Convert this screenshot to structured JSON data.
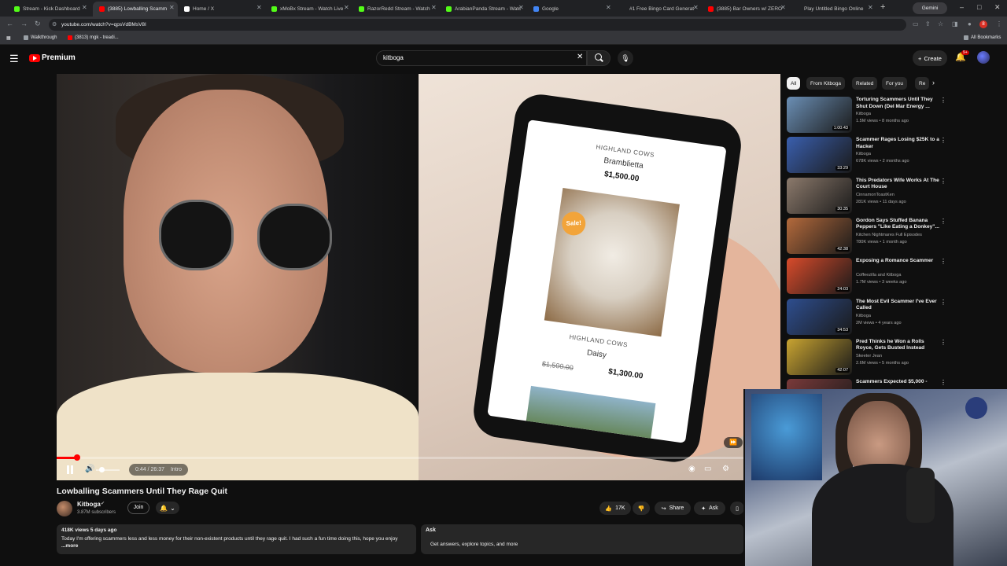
{
  "browser": {
    "tabs": [
      {
        "label": "Stream - Kick Dashboard",
        "color": "#53fc18"
      },
      {
        "label": "(3885) Lowballing Scamm",
        "color": "#ff0000"
      },
      {
        "label": "Home / X",
        "color": "#ffffff"
      },
      {
        "label": "xMoBx Stream - Watch Live",
        "color": "#53fc18"
      },
      {
        "label": "RazorRedd Stream - Watch",
        "color": "#53fc18"
      },
      {
        "label": "ArabianPanda Stream - Watc",
        "color": "#53fc18"
      },
      {
        "label": "Google",
        "color": "#4285f4"
      },
      {
        "label": "#1 Free Bingo Card Generat",
        "color": "#9aa0a6"
      },
      {
        "label": "(3885) Bar Owners w/ ZERO",
        "color": "#ff0000"
      },
      {
        "label": "Play Untitled Bingo Online",
        "color": "#9aa0a6"
      }
    ],
    "gemini_label": "Gemini",
    "url": "youtube.com/watch?v=qpsVdBMsV8I",
    "extension_badge": "8",
    "bookmarks": [
      {
        "label": "Walkthrough",
        "color": "#9aa0a6"
      },
      {
        "label": "(3813) mgk - treadi...",
        "color": "#ff0000"
      }
    ],
    "all_bookmarks_label": "All Bookmarks"
  },
  "header": {
    "logo_text": "Premium",
    "search_value": "kitboga",
    "create_label": "Create",
    "notifications_badge": "9+"
  },
  "player": {
    "phone": {
      "item1_breed": "HIGHLAND COWS",
      "item1_name": "Bramblietta",
      "item1_price": "$1,500.00",
      "sale_badge": "Sale!",
      "item2_breed": "HIGHLAND COWS",
      "item2_name": "Daisy",
      "item2_old_price": "$1,500.00",
      "item2_price": "$1,300.00"
    },
    "progress": 0.028,
    "time_current": "0:44 / 26:37",
    "chapter_label": "Intro"
  },
  "video": {
    "title": "Lowballing Scammers Until They Rage Quit",
    "channel": "Kitboga",
    "subscribers": "3.87M subscribers",
    "join_label": "Join",
    "likes": "17K",
    "share_label": "Share",
    "ask_label": "Ask",
    "description_meta": "418K views  5 days ago",
    "description_text": "Today I'm offering scammers less and less money for their non-existent products until they rage quit. I had such a fun time doing this, hope you enjoy",
    "description_more": "...more",
    "ask_panel_title": "Ask",
    "ask_panel_chip": "Get answers, explore topics, and more"
  },
  "sidebar": {
    "chips": [
      "All",
      "From Kitboga",
      "Related",
      "For you",
      "Re"
    ],
    "recommendations": [
      {
        "title": "Torturing Scammers Until They Shut Down (Del Mar Energy ...",
        "channel": "Kitboga",
        "meta": "1.5M views • 8 months ago",
        "duration": "1:00:43",
        "thumb": "#6b8fb5"
      },
      {
        "title": "Scammer Rages Losing $25K to a Hacker",
        "channel": "Kitboga",
        "meta": "678K views • 2 months ago",
        "duration": "33:29",
        "thumb": "#3a5fae"
      },
      {
        "title": "This Predators Wife Works At The Court House",
        "channel": "CinnamonToastKen",
        "meta": "281K views • 11 days ago",
        "duration": "30:35",
        "thumb": "#8c7a6c"
      },
      {
        "title": "Gordon Says Stuffed Banana Peppers \"Like Eating a Donkey\"...",
        "channel": "Kitchen Nightmares Full Episodes",
        "meta": "780K views • 1 month ago",
        "duration": "42:38",
        "thumb": "#b46a3c"
      },
      {
        "title": "Exposing a Romance Scammer",
        "channel": "Coffeezilla and Kitboga",
        "meta": "1.7M views • 3 weeks ago",
        "duration": "24:03",
        "thumb": "#d94b2b"
      },
      {
        "title": "The Most Evil Scammer I've Ever Called",
        "channel": "Kitboga",
        "meta": "2M views • 4 years ago",
        "duration": "34:53",
        "thumb": "#2e4e8f"
      },
      {
        "title": "Pred Thinks he Won a Rolls Royce, Gets Busted Instead",
        "channel": "Skeeter Jean",
        "meta": "2.6M views • 5 months ago",
        "duration": "42:07",
        "thumb": "#c9a431"
      },
      {
        "title": "Scammers Expected $5,000 -",
        "channel": "",
        "meta": "",
        "duration": "",
        "thumb": "#7a3a3a"
      }
    ]
  }
}
